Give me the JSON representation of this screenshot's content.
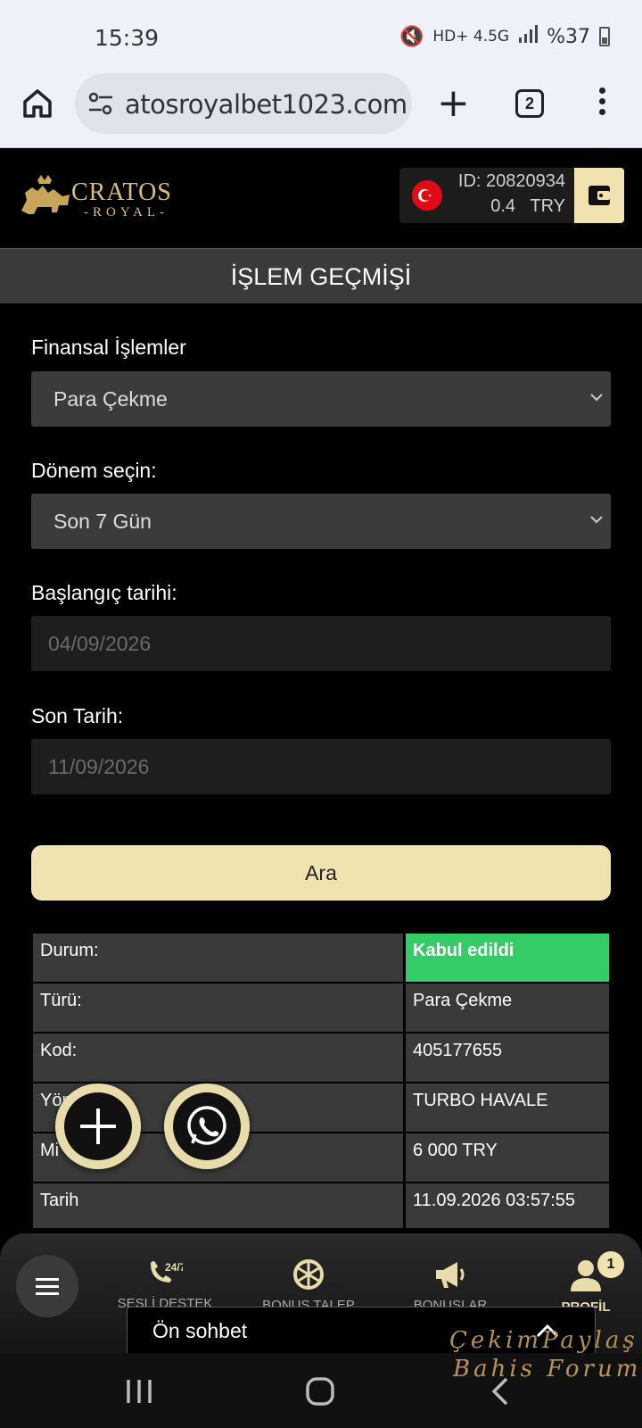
{
  "status_bar": {
    "time": "15:39",
    "indicators": "HD+ 4.5G",
    "battery": "%37"
  },
  "browser": {
    "url": "atosroyalbet1023.com",
    "tab_count": "2",
    "icons": [
      "home-icon",
      "site-settings-icon",
      "new-tab-icon",
      "tab-switcher-icon",
      "more-icon"
    ]
  },
  "header": {
    "logo": "CRATOS ROYAL",
    "account_id": "ID: 20820934",
    "balance": "0.4   TRY",
    "wallet_icon": "wallet-icon"
  },
  "page": {
    "title": "İŞLEM GEÇMİŞİ"
  },
  "filters": {
    "financial_label": "Finansal İşlemler",
    "financial_value": "Para Çekme",
    "period_label": "Dönem seçin:",
    "period_value": "Son 7 Gün",
    "start_label": "Başlangıç tarihi:",
    "start_value": "04/09/2026",
    "end_label": "Son Tarih:",
    "end_value": "11/09/2026",
    "search_button": "Ara"
  },
  "transaction": {
    "rows": [
      {
        "key": "Durum:",
        "value": "Kabul edildi"
      },
      {
        "key": "Türü:",
        "value": "Para Çekme"
      },
      {
        "key": "Kod:",
        "value": "405177655"
      },
      {
        "key": "Yön",
        "value": "TURBO HAVALE"
      },
      {
        "key": "Mi",
        "value": "6 000 TRY"
      },
      {
        "key": "Tarih",
        "value": "11.09.2026 03:57:55"
      }
    ],
    "status_color": "#33cc66"
  },
  "bottom_nav": {
    "items": [
      {
        "label": "SESLİ DESTEK",
        "icon": "phone-24-7-icon"
      },
      {
        "label": "BONUS TALEP",
        "icon": "wheel-icon"
      },
      {
        "label": "BONUSLAR",
        "icon": "megaphone-icon"
      },
      {
        "label": "PROFİL",
        "icon": "user-icon"
      }
    ],
    "profile_badge": "1"
  },
  "chat": {
    "label": "Ön sohbet"
  },
  "watermark": {
    "line1": "ÇekimPaylaş",
    "line2": "Bahis Forum"
  },
  "colors": {
    "accent": "#f0e3b0",
    "background": "#000000",
    "panel": "#3a3a3a"
  }
}
